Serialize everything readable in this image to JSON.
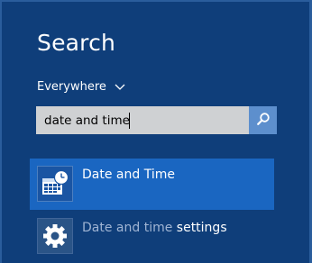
{
  "panel": {
    "title": "Search",
    "scope": {
      "label": "Everywhere",
      "icon": "chevron-down-icon"
    },
    "search": {
      "value": "date and time",
      "button_icon": "search-icon"
    },
    "results": [
      {
        "label": "Date and Time",
        "icon": "calendar-clock-icon",
        "selected": true
      },
      {
        "label_prefix": "Date and time ",
        "label_match": "settings",
        "icon": "gear-icon",
        "selected": false
      }
    ]
  },
  "colors": {
    "background": "#0f3e7a",
    "selected_row": "#1a66c1",
    "search_box": "#cfd1d3",
    "search_button": "#5d8fcd",
    "muted_text": "#9fb4d3"
  }
}
